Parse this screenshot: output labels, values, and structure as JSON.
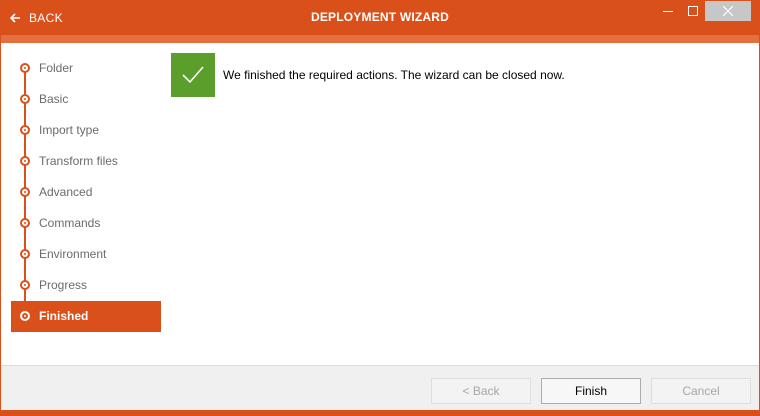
{
  "window": {
    "back_label": "BACK",
    "title": "DEPLOYMENT WIZARD",
    "accent_color": "#d9501a"
  },
  "steps": [
    {
      "label": "Folder",
      "active": false
    },
    {
      "label": "Basic",
      "active": false
    },
    {
      "label": "Import type",
      "active": false
    },
    {
      "label": "Transform files",
      "active": false
    },
    {
      "label": "Advanced",
      "active": false
    },
    {
      "label": "Commands",
      "active": false
    },
    {
      "label": "Environment",
      "active": false
    },
    {
      "label": "Progress",
      "active": false
    },
    {
      "label": "Finished",
      "active": true
    }
  ],
  "result": {
    "icon": "checkmark-icon",
    "status_color": "#5c9e2b",
    "message": "We finished the required actions. The wizard can be closed now."
  },
  "footer": {
    "back_label": "< Back",
    "finish_label": "Finish",
    "cancel_label": "Cancel"
  }
}
